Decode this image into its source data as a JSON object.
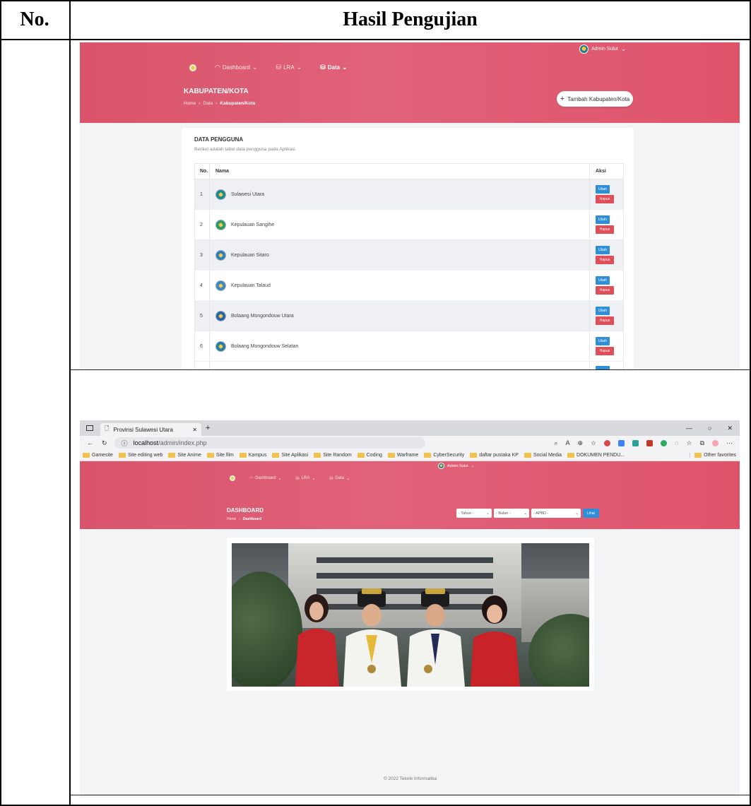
{
  "table_header": {
    "no": "No.",
    "hasil": "Hasil Pengujian"
  },
  "shot1": {
    "admin": "Admin Sulut",
    "nav": [
      {
        "label": "Dashboard",
        "icon": "gauge-icon"
      },
      {
        "label": "LRA",
        "icon": "db-icon"
      },
      {
        "label": "Data",
        "icon": "db-icon"
      }
    ],
    "page_title": "KABUPATEN/KOTA",
    "breadcrumb": [
      "Home",
      "Data",
      "Kabupaten/Kota"
    ],
    "add_button": "Tambah Kabupaten/Kota",
    "card_title": "DATA PENGGUNA",
    "card_subtitle": "Berikut adalah tabel data pengguna pada Aplikasi.",
    "columns": [
      "No.",
      "Nama",
      "Aksi"
    ],
    "rows": [
      {
        "no": "1",
        "nama": "Sulawesi Utara",
        "logo_color": "#1b8a8f"
      },
      {
        "no": "2",
        "nama": "Kepulauan Sangihe",
        "logo_color": "#2e9c6a"
      },
      {
        "no": "3",
        "nama": "Kepulauan Sitaro",
        "logo_color": "#2f7fb8"
      },
      {
        "no": "4",
        "nama": "Kepulauan Talaud",
        "logo_color": "#3d86c6"
      },
      {
        "no": "5",
        "nama": "Bolaang Mongondouw Utara",
        "logo_color": "#2a64a8"
      },
      {
        "no": "6",
        "nama": "Bolaang Mongondouw Selatan",
        "logo_color": "#2a7d9c"
      }
    ],
    "edit_label": "Ubah",
    "delete_label": "Hapus"
  },
  "shot2": {
    "tab_title": "Provinsi Sulawesi Utara",
    "url_host": "localhost",
    "url_path": "/admin/index.php",
    "bookmarks": [
      "Gamesite",
      "Site editing web",
      "Site Anime",
      "Site film",
      "Kampus",
      "Site Aplikasi",
      "Site Random",
      "Coding",
      "Warframe",
      "CyberSecurity",
      "daftar pustaka KP",
      "Social Media",
      "DOKUMEN PENDU..."
    ],
    "other_favorites": "Other favorites",
    "admin": "Admin Sulut",
    "nav": [
      {
        "label": "Dashboard"
      },
      {
        "label": "LRA"
      },
      {
        "label": "Data"
      }
    ],
    "page_title": "DASHBOARD",
    "breadcrumb": [
      "Home",
      "Dashboard"
    ],
    "filters": [
      "- Tahun -",
      "- Bulan -",
      "- APBD -"
    ],
    "view_button": "Lihat",
    "footer": "© 2022 Teknik Informatika"
  }
}
